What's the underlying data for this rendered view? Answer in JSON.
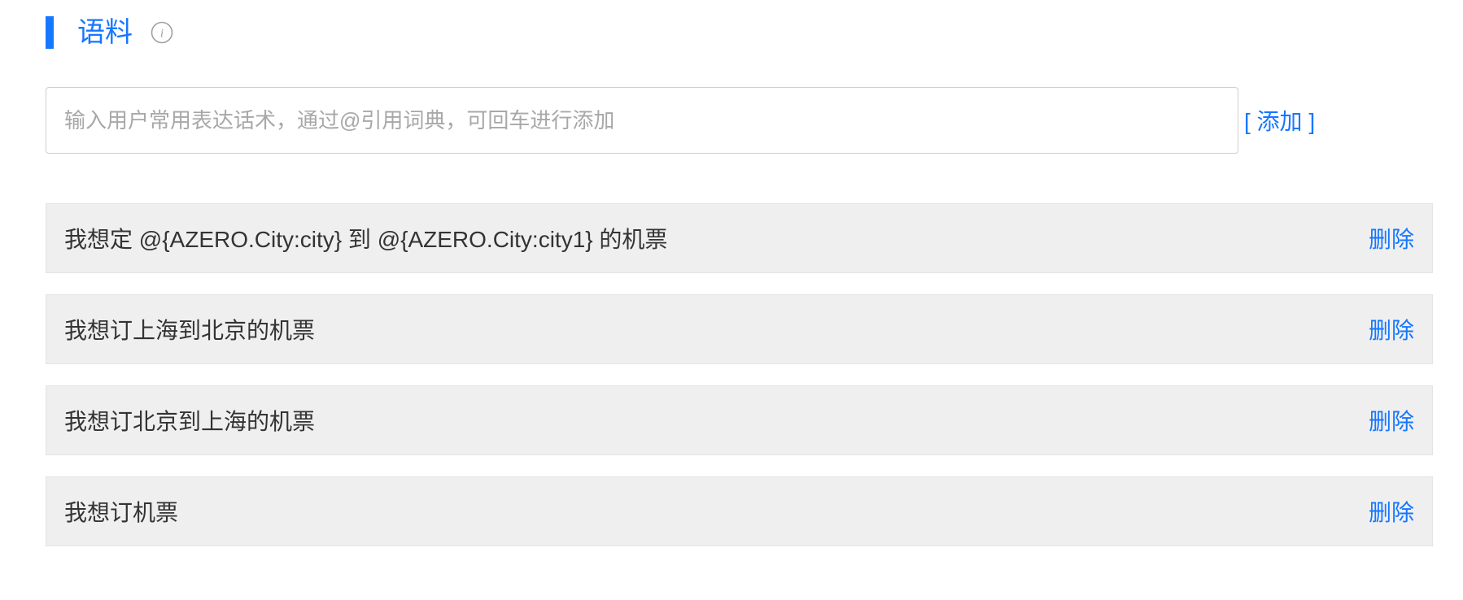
{
  "section": {
    "title": "语料",
    "info_icon": "info-circle-icon",
    "accent_color": "#1677ff"
  },
  "input": {
    "value": "",
    "placeholder": "输入用户常用表达话术，通过@引用词典，可回车进行添加",
    "add_label": "[ 添加 ]"
  },
  "utterances": [
    {
      "text": "我想定 @{AZERO.City:city} 到 @{AZERO.City:city1} 的机票",
      "delete_label": "删除"
    },
    {
      "text": "我想订上海到北京的机票",
      "delete_label": "删除"
    },
    {
      "text": "我想订北京到上海的机票",
      "delete_label": "删除"
    },
    {
      "text": "我想订机票",
      "delete_label": "删除"
    }
  ]
}
